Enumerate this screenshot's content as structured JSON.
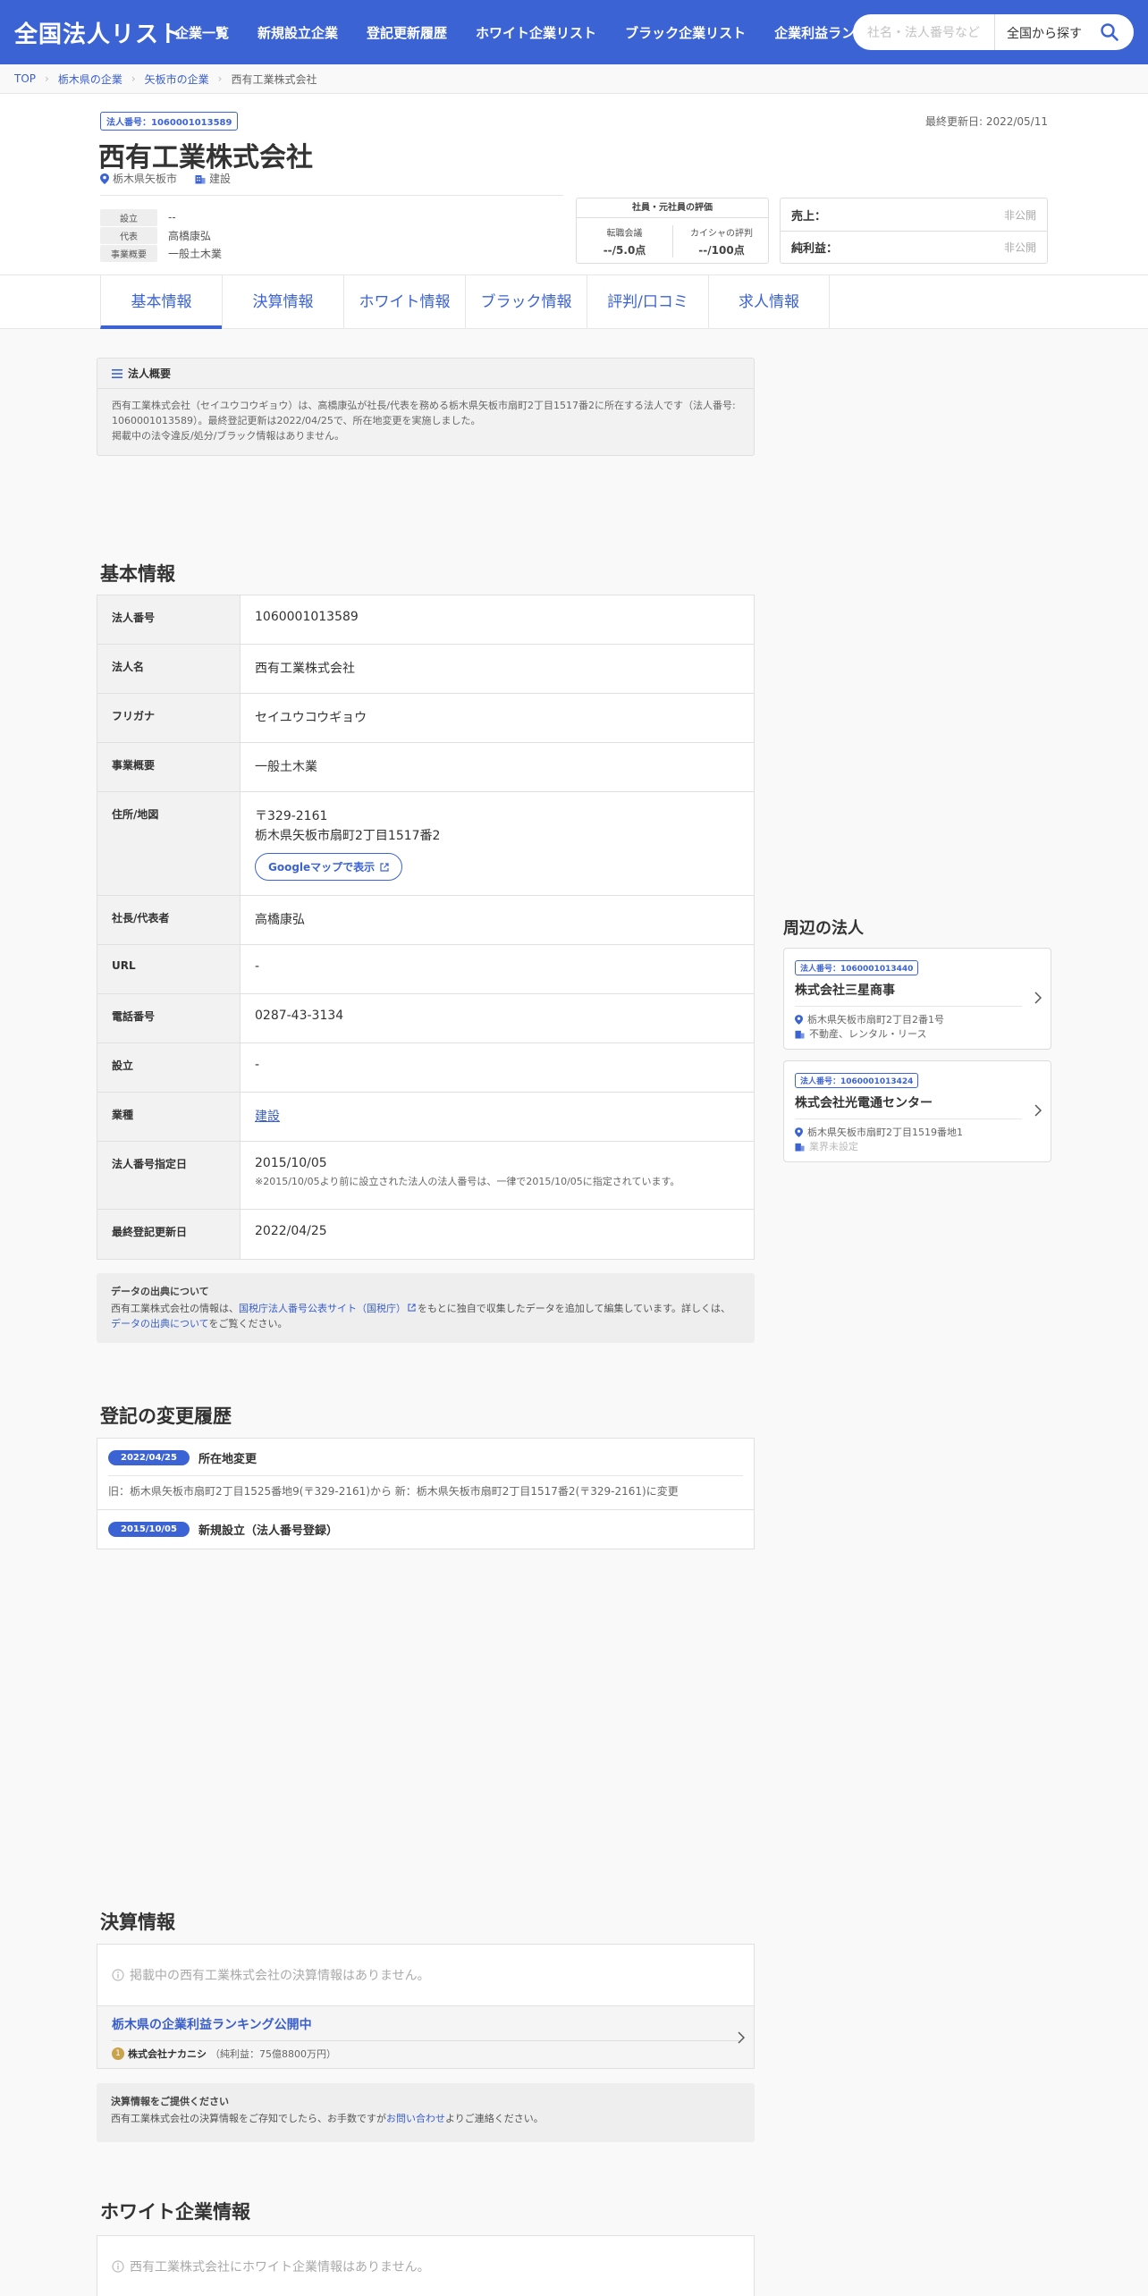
{
  "header": {
    "logo": "全国法人リスト",
    "nav": [
      "企業一覧",
      "新規設立企業",
      "登記更新履歴",
      "ホワイト企業リスト",
      "ブラック企業リスト",
      "企業利益ランキング"
    ],
    "search_placeholder": "社名・法人番号など",
    "search_scope": "全国から探す"
  },
  "breadcrumb": [
    "TOP",
    "栃木県の企業",
    "矢板市の企業",
    "西有工業株式会社"
  ],
  "company": {
    "badge": "法人番号：1060001013589",
    "last_updated": "最終更新日: 2022/05/11",
    "name": "西有工業株式会社",
    "location": "栃木県矢板市",
    "industry": "建設",
    "mini": [
      {
        "label": "設立",
        "value": "--"
      },
      {
        "label": "代表",
        "value": "高橋康弘"
      },
      {
        "label": "事業概要",
        "value": "一般土木業"
      }
    ],
    "review": {
      "title": "社員・元社員の評価",
      "left_label": "転職会議",
      "left_value": "--/5.0点",
      "right_label": "カイシャの評判",
      "right_value": "--/100点"
    },
    "finance": [
      {
        "label": "売上：",
        "value": "非公開"
      },
      {
        "label": "純利益：",
        "value": "非公開"
      }
    ]
  },
  "tabs": [
    "基本情報",
    "決算情報",
    "ホワイト情報",
    "ブラック情報",
    "評判/口コミ",
    "求人情報"
  ],
  "overview": {
    "title": "法人概要",
    "line1": "西有工業株式会社（セイユウコウギョウ）は、高橋康弘が社長/代表を務める栃木県矢板市扇町2丁目1517番2に所在する法人です（法人番号:",
    "line2": "1060001013589）。最終登記更新は2022/04/25で、所在地変更を実施しました。",
    "line3": "掲載中の法令違反/処分/ブラック情報はありません。"
  },
  "basic": {
    "title": "基本情報",
    "rows": [
      {
        "label": "法人番号",
        "value": "1060001013589"
      },
      {
        "label": "法人名",
        "value": "西有工業株式会社"
      },
      {
        "label": "フリガナ",
        "value": "セイユウコウギョウ"
      },
      {
        "label": "事業概要",
        "value": "一般土木業"
      },
      {
        "label": "住所/地図",
        "value": "〒329-2161",
        "value2": "栃木県矢板市扇町2丁目1517番2",
        "button": "Googleマップで表示"
      },
      {
        "label": "社長/代表者",
        "value": "高橋康弘"
      },
      {
        "label": "URL",
        "value": "-"
      },
      {
        "label": "電話番号",
        "value": "0287-43-3134"
      },
      {
        "label": "設立",
        "value": "-"
      },
      {
        "label": "業種",
        "value": "建設"
      },
      {
        "label": "法人番号指定日",
        "value": "2015/10/05",
        "note": "※2015/10/05より前に設立された法人の法人番号は、一律で2015/10/05に指定されています。"
      },
      {
        "label": "最終登記更新日",
        "value": "2022/04/25"
      }
    ]
  },
  "source": {
    "title": "データの出典について",
    "text_before": "西有工業株式会社の情報は、",
    "link": "国税庁法人番号公表サイト（国税庁）",
    "text_after": "をもとに独自で収集したデータを追加して編集しています。詳しくは、",
    "link2": "データの出典について",
    "text_end": "をご覧ください。"
  },
  "history": {
    "title": "登記の変更履歴",
    "items": [
      {
        "date": "2022/04/25",
        "title": "所在地変更",
        "detail": "旧：栃木県矢板市扇町2丁目1525番地9(〒329-2161)から 新：栃木県矢板市扇町2丁目1517番2(〒329-2161)に変更"
      },
      {
        "date": "2015/10/05",
        "title": "新規設立（法人番号登録）"
      }
    ]
  },
  "settlement": {
    "title": "決算情報",
    "empty": "掲載中の西有工業株式会社の決算情報はありません。",
    "ranking_title": "栃木県の企業利益ランキング公開中",
    "rank_no": "1",
    "rank_company": "株式会社ナカニシ",
    "rank_detail": "（純利益：75億8800万円）",
    "provide_title": "決算情報をご提供ください",
    "provide_before": "西有工業株式会社の決算情報をご存知でしたら、お手数ですが",
    "provide_link": "お問い合わせ",
    "provide_after": "よりご連絡ください。"
  },
  "white": {
    "title": "ホワイト企業情報",
    "empty": "西有工業株式会社にホワイト企業情報はありません。"
  },
  "nearby": {
    "title": "周辺の法人",
    "items": [
      {
        "badge": "法人番号：1060001013440",
        "name": "株式会社三星商事",
        "address": "栃木県矢板市扇町2丁目2番1号",
        "industry": "不動産、レンタル・リース"
      },
      {
        "badge": "法人番号：1060001013424",
        "name": "株式会社光電通センター",
        "address": "栃木県矢板市扇町2丁目1519番地1",
        "industry": "業界未設定"
      }
    ]
  }
}
